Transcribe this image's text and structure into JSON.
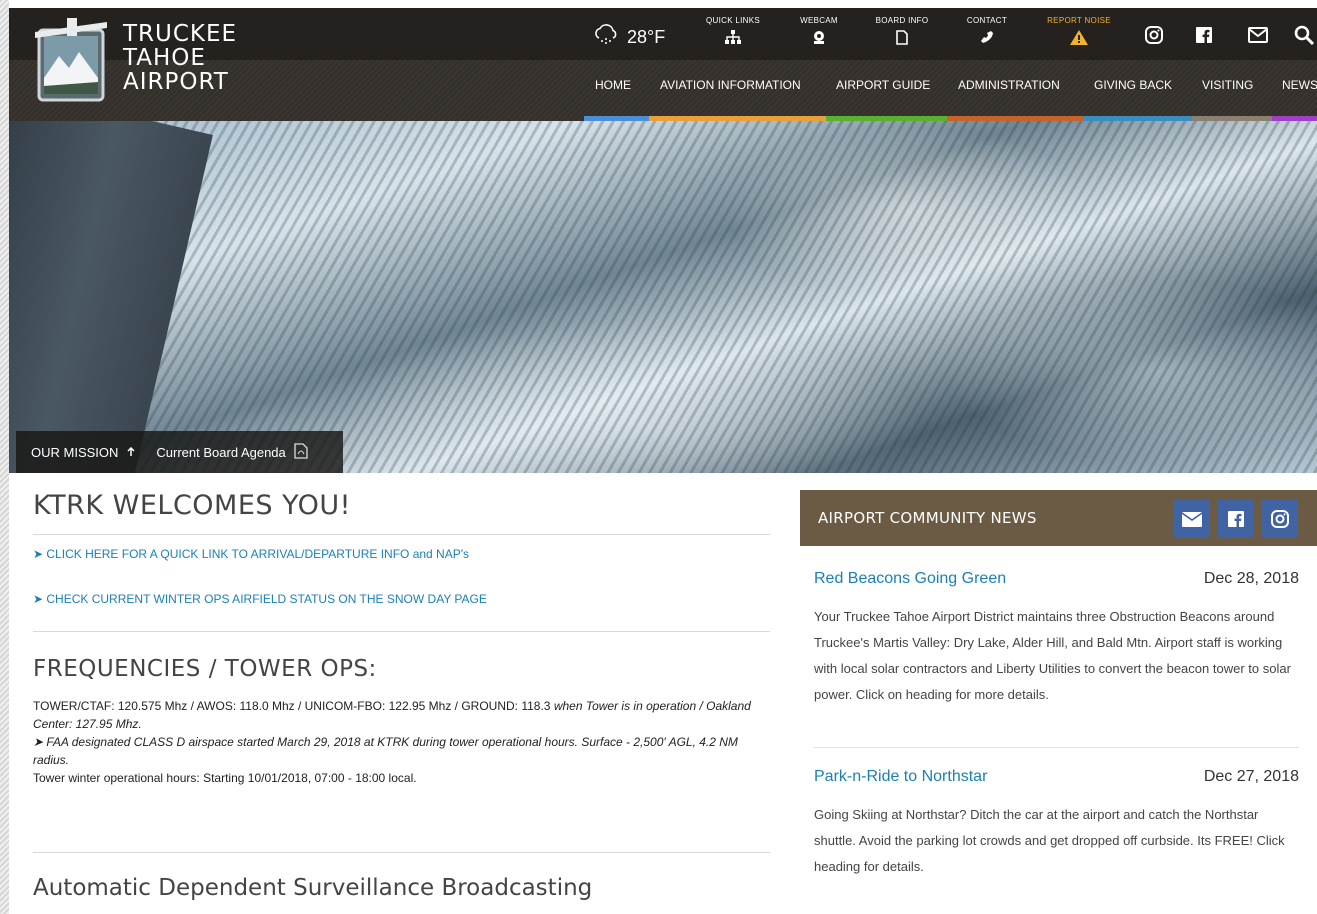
{
  "brand": {
    "line1": "TRUCKEE",
    "line2": "TAHOE",
    "line3": "AIRPORT"
  },
  "weather": {
    "icon": "snow-cloud-icon",
    "temp": "28°F"
  },
  "quick_links": [
    {
      "label": "QUICK LINKS",
      "icon": "sitemap-icon"
    },
    {
      "label": "WEBCAM",
      "icon": "webcam-icon"
    },
    {
      "label": "BOARD INFO",
      "icon": "document-icon"
    },
    {
      "label": "CONTACT",
      "icon": "phone-icon"
    },
    {
      "label": "REPORT NOISE",
      "icon": "warning-icon"
    }
  ],
  "header_social": [
    "instagram-icon",
    "facebook-icon",
    "mail-icon",
    "search-icon"
  ],
  "nav": [
    {
      "label": "HOME",
      "color": "#4a90d9"
    },
    {
      "label": "AVIATION INFORMATION",
      "color": "#e8a03a"
    },
    {
      "label": "AIRPORT GUIDE",
      "color": "#5cb030"
    },
    {
      "label": "ADMINISTRATION",
      "color": "#c5642a"
    },
    {
      "label": "GIVING BACK",
      "color": "#3a8fc0"
    },
    {
      "label": "VISITING",
      "color": "#8b8070"
    },
    {
      "label": "NEWS",
      "color": "#a040c8"
    }
  ],
  "hero": {
    "mission_label": "OUR MISSION",
    "agenda_label": "Current Board Agenda"
  },
  "main": {
    "welcome_title": "KTRK WELCOMES YOU!",
    "link_arrival": "➤ CLICK HERE FOR A QUICK LINK TO ARRIVAL/DEPARTURE INFO and NAP's",
    "link_winter": "➤ CHECK CURRENT WINTER OPS AIRFIELD STATUS ON THE SNOW DAY PAGE",
    "freq_title": "FREQUENCIES / TOWER OPS:",
    "freq_line1": "TOWER/CTAF: 120.575 Mhz / AWOS: 118.0 Mhz / UNICOM-FBO: 122.95 Mhz / GROUND: 118.3",
    "freq_line1_italic": "when Tower is in operation / Oakland Center: 127.95 Mhz.",
    "freq_line2": "➤ FAA designated CLASS D airspace started March 29, 2018 at KTRK during tower operational hours.  Surface - 2,500' AGL, 4.2 NM radius.",
    "freq_line3": " Tower winter operational hours:  Starting 10/01/2018,  07:00 - 18:00 local.",
    "adsb_title": "Automatic Dependent Surveillance Broadcasting"
  },
  "news": {
    "header": "AIRPORT COMMUNITY NEWS",
    "buttons": [
      "mail-icon",
      "facebook-icon",
      "instagram-icon"
    ],
    "posts": [
      {
        "title": "Red Beacons Going Green",
        "date": "Dec 28, 2018",
        "body": "Your Truckee Tahoe Airport District maintains three Obstruction Beacons around Truckee's Martis Valley: Dry Lake, Alder Hill, and Bald Mtn. Airport staff is working with local solar contractors and Liberty Utilities to convert the beacon tower to solar power. Click on heading for more details."
      },
      {
        "title": "Park-n-Ride to Northstar",
        "date": "Dec 27, 2018",
        "body": "Going Skiing at Northstar? Ditch the car at the airport and catch the Northstar shuttle.  Avoid the parking lot crowds and get dropped off curbside. Its FREE! Click heading for details."
      }
    ]
  }
}
